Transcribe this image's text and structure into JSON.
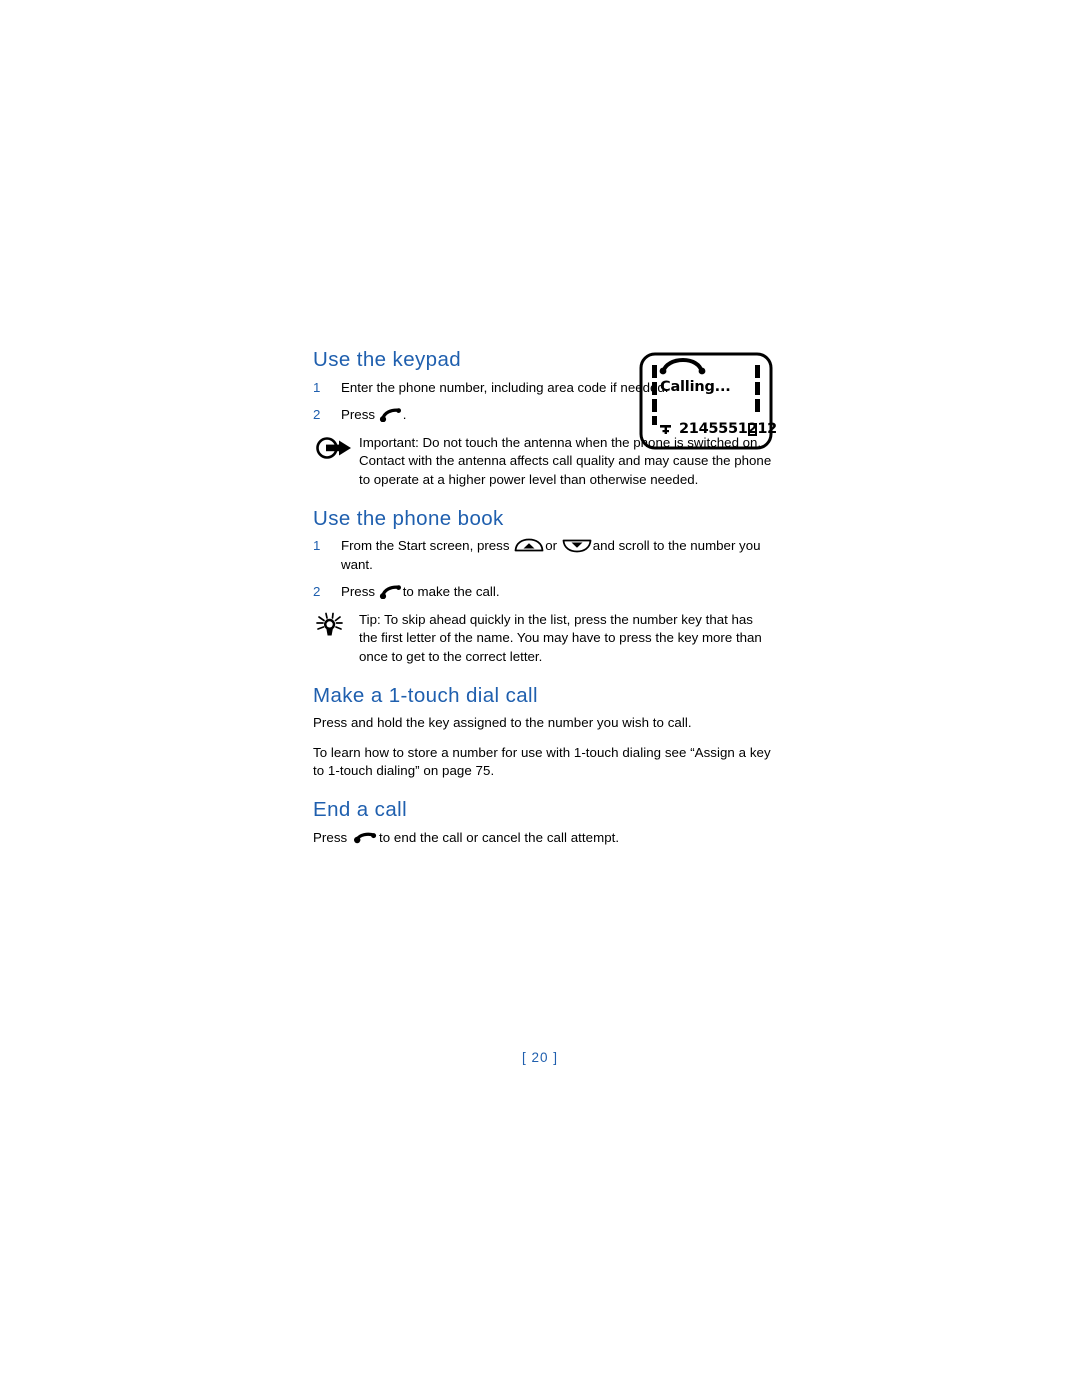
{
  "document": {
    "page_label": "[ 20 ]"
  },
  "sections": [
    {
      "id": "use-the-keypad",
      "heading": "Use the keypad",
      "steps": [
        {
          "num": "1",
          "text": "Enter the phone number, including area code if needed."
        },
        {
          "num": "2",
          "text_before": "Press",
          "icon": "send-key-icon",
          "text_after": "."
        }
      ],
      "note": {
        "kind": "important",
        "icon": "important-arrow-icon",
        "lead": "Important: Do not touch the antenna",
        "text": "when the phone is switched on. Contact with the antenna affects call quality and may cause the phone to operate at a higher power level than otherwise needed."
      }
    },
    {
      "id": "use-the-phone-book",
      "heading": "Use the phone book",
      "steps": [
        {
          "num": "1",
          "text_before": "From the Start screen, press",
          "icon_up": "scroll-up-key-icon",
          "text_middle": "or",
          "icon_down": "scroll-down-key-icon",
          "text_after": "and scroll to the number you want."
        },
        {
          "num": "2",
          "text_before": "Press",
          "icon": "send-key-icon",
          "text_after": "to make the call."
        }
      ],
      "note": {
        "kind": "tip",
        "icon": "tip-lightbulb-icon",
        "text": "Tip: To skip ahead quickly in the list, press the number key that has the first letter of the name. You may have to press the key more than once to get to the correct letter."
      }
    },
    {
      "id": "make-a-1-touch-dial-call",
      "heading": "Make a 1-touch dial call",
      "paragraphs": [
        "Press and hold the key assigned to the number you wish to call.",
        "To learn how to store a number for use with 1-touch dialing see “Assign a key to 1-touch dialing” on page 75."
      ]
    },
    {
      "id": "end-a-call",
      "heading": "End a call",
      "end_call": {
        "text_before": "Press",
        "icon": "end-key-icon",
        "text_after": "to end the call or cancel the call attempt."
      }
    }
  ],
  "phone_display": {
    "name": "phone-screen-illustration",
    "status_icon": "call-in-progress-icon",
    "status_text": "Calling...",
    "signal_icon": "signal-antenna-icon",
    "number": "2145551212",
    "battery_icon": "battery-icon"
  },
  "colors": {
    "heading_blue": "#1F5FAE",
    "text_black": "#000000",
    "page_background": "#FFFFFF"
  }
}
